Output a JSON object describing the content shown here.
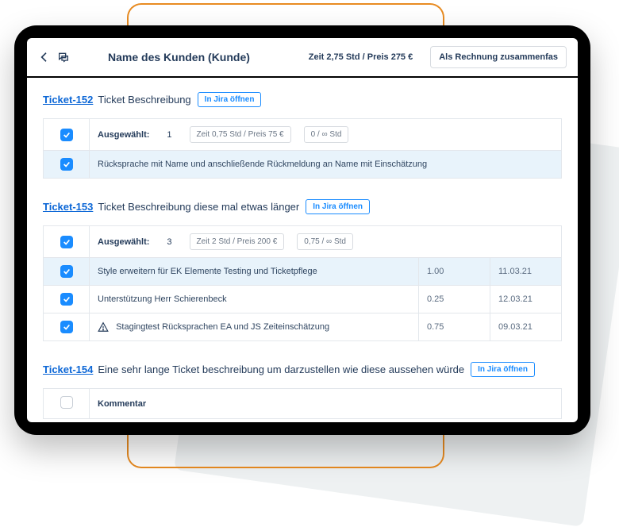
{
  "header": {
    "title": "Name des Kunden (Kunde)",
    "meta": "Zeit 2,75 Std / Preis 275 €",
    "invoice_button": "Als Rechnung zusammenfas"
  },
  "common": {
    "jira_button": "In Jira öffnen",
    "selected_label": "Ausgewählt:"
  },
  "tickets": [
    {
      "id": "Ticket-152",
      "desc": "Ticket Beschreibung",
      "selected_count": "1",
      "pill_time": "Zeit 0,75 Std / Preis 75 €",
      "pill_hours": "0 / ∞ Std",
      "rows": [
        {
          "checked": true,
          "highlight": true,
          "desc": "Rücksprache mit Name und anschließende Rückmeldung an Name mit Einschätzung",
          "val": "",
          "date": ""
        }
      ]
    },
    {
      "id": "Ticket-153",
      "desc": "Ticket Beschreibung diese mal etwas länger",
      "selected_count": "3",
      "pill_time": "Zeit 2 Std / Preis 200 €",
      "pill_hours": "0,75 / ∞ Std",
      "rows": [
        {
          "checked": true,
          "highlight": true,
          "desc": "Style erweitern für EK Elemente Testing und Ticketpflege",
          "val": "1.00",
          "date": "11.03.21"
        },
        {
          "checked": true,
          "highlight": false,
          "desc": "Unterstützung Herr Schierenbeck",
          "val": "0.25",
          "date": "12.03.21"
        },
        {
          "checked": true,
          "highlight": false,
          "warn": true,
          "desc": "Stagingtest Rücksprachen EA und JS Zeiteinschätzung",
          "val": "0.75",
          "date": "09.03.21"
        }
      ]
    },
    {
      "id": "Ticket-154",
      "desc": "Eine sehr lange Ticket beschreibung um darzustellen wie diese aussehen würde",
      "selected_count": "",
      "pill_time": "",
      "pill_hours": "",
      "comment_label": "Kommentar",
      "rows": []
    }
  ]
}
